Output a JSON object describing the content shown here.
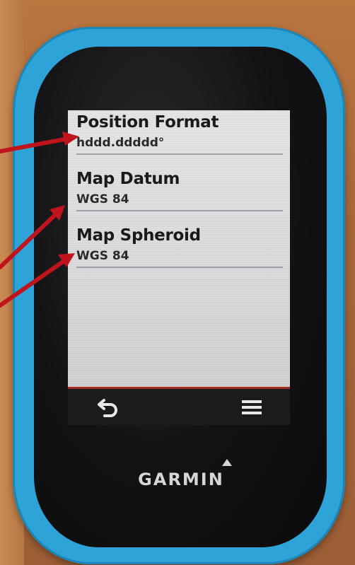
{
  "settings": [
    {
      "label": "Position Format",
      "value": "hddd.ddddd°"
    },
    {
      "label": "Map Datum",
      "value": "WGS 84"
    },
    {
      "label": "Map Spheroid",
      "value": "WGS 84"
    }
  ],
  "softkeys": {
    "back_icon": "back-arrow-icon",
    "menu_icon": "hamburger-menu-icon"
  },
  "brand": {
    "name": "GARMIN"
  },
  "colors": {
    "device_blue": "#2da3d8",
    "annotation_red": "#c0141c",
    "lcd_background": "#dedee0"
  }
}
